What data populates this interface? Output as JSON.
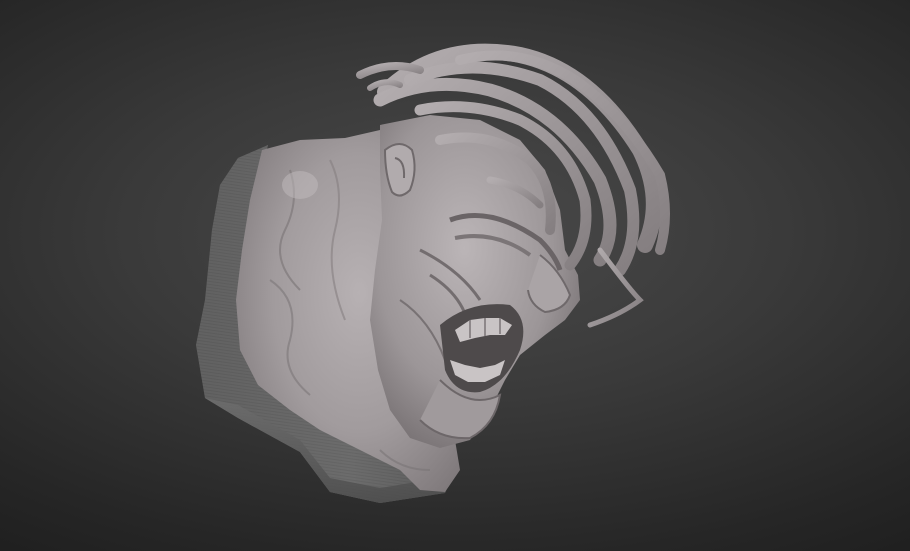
{
  "viewport": {
    "background_colors": [
      "#4a4a4a",
      "#262626",
      "#1b1b1b"
    ]
  },
  "model": {
    "material_color": "#a39d9f",
    "base_color": "#6c6c6c"
  }
}
